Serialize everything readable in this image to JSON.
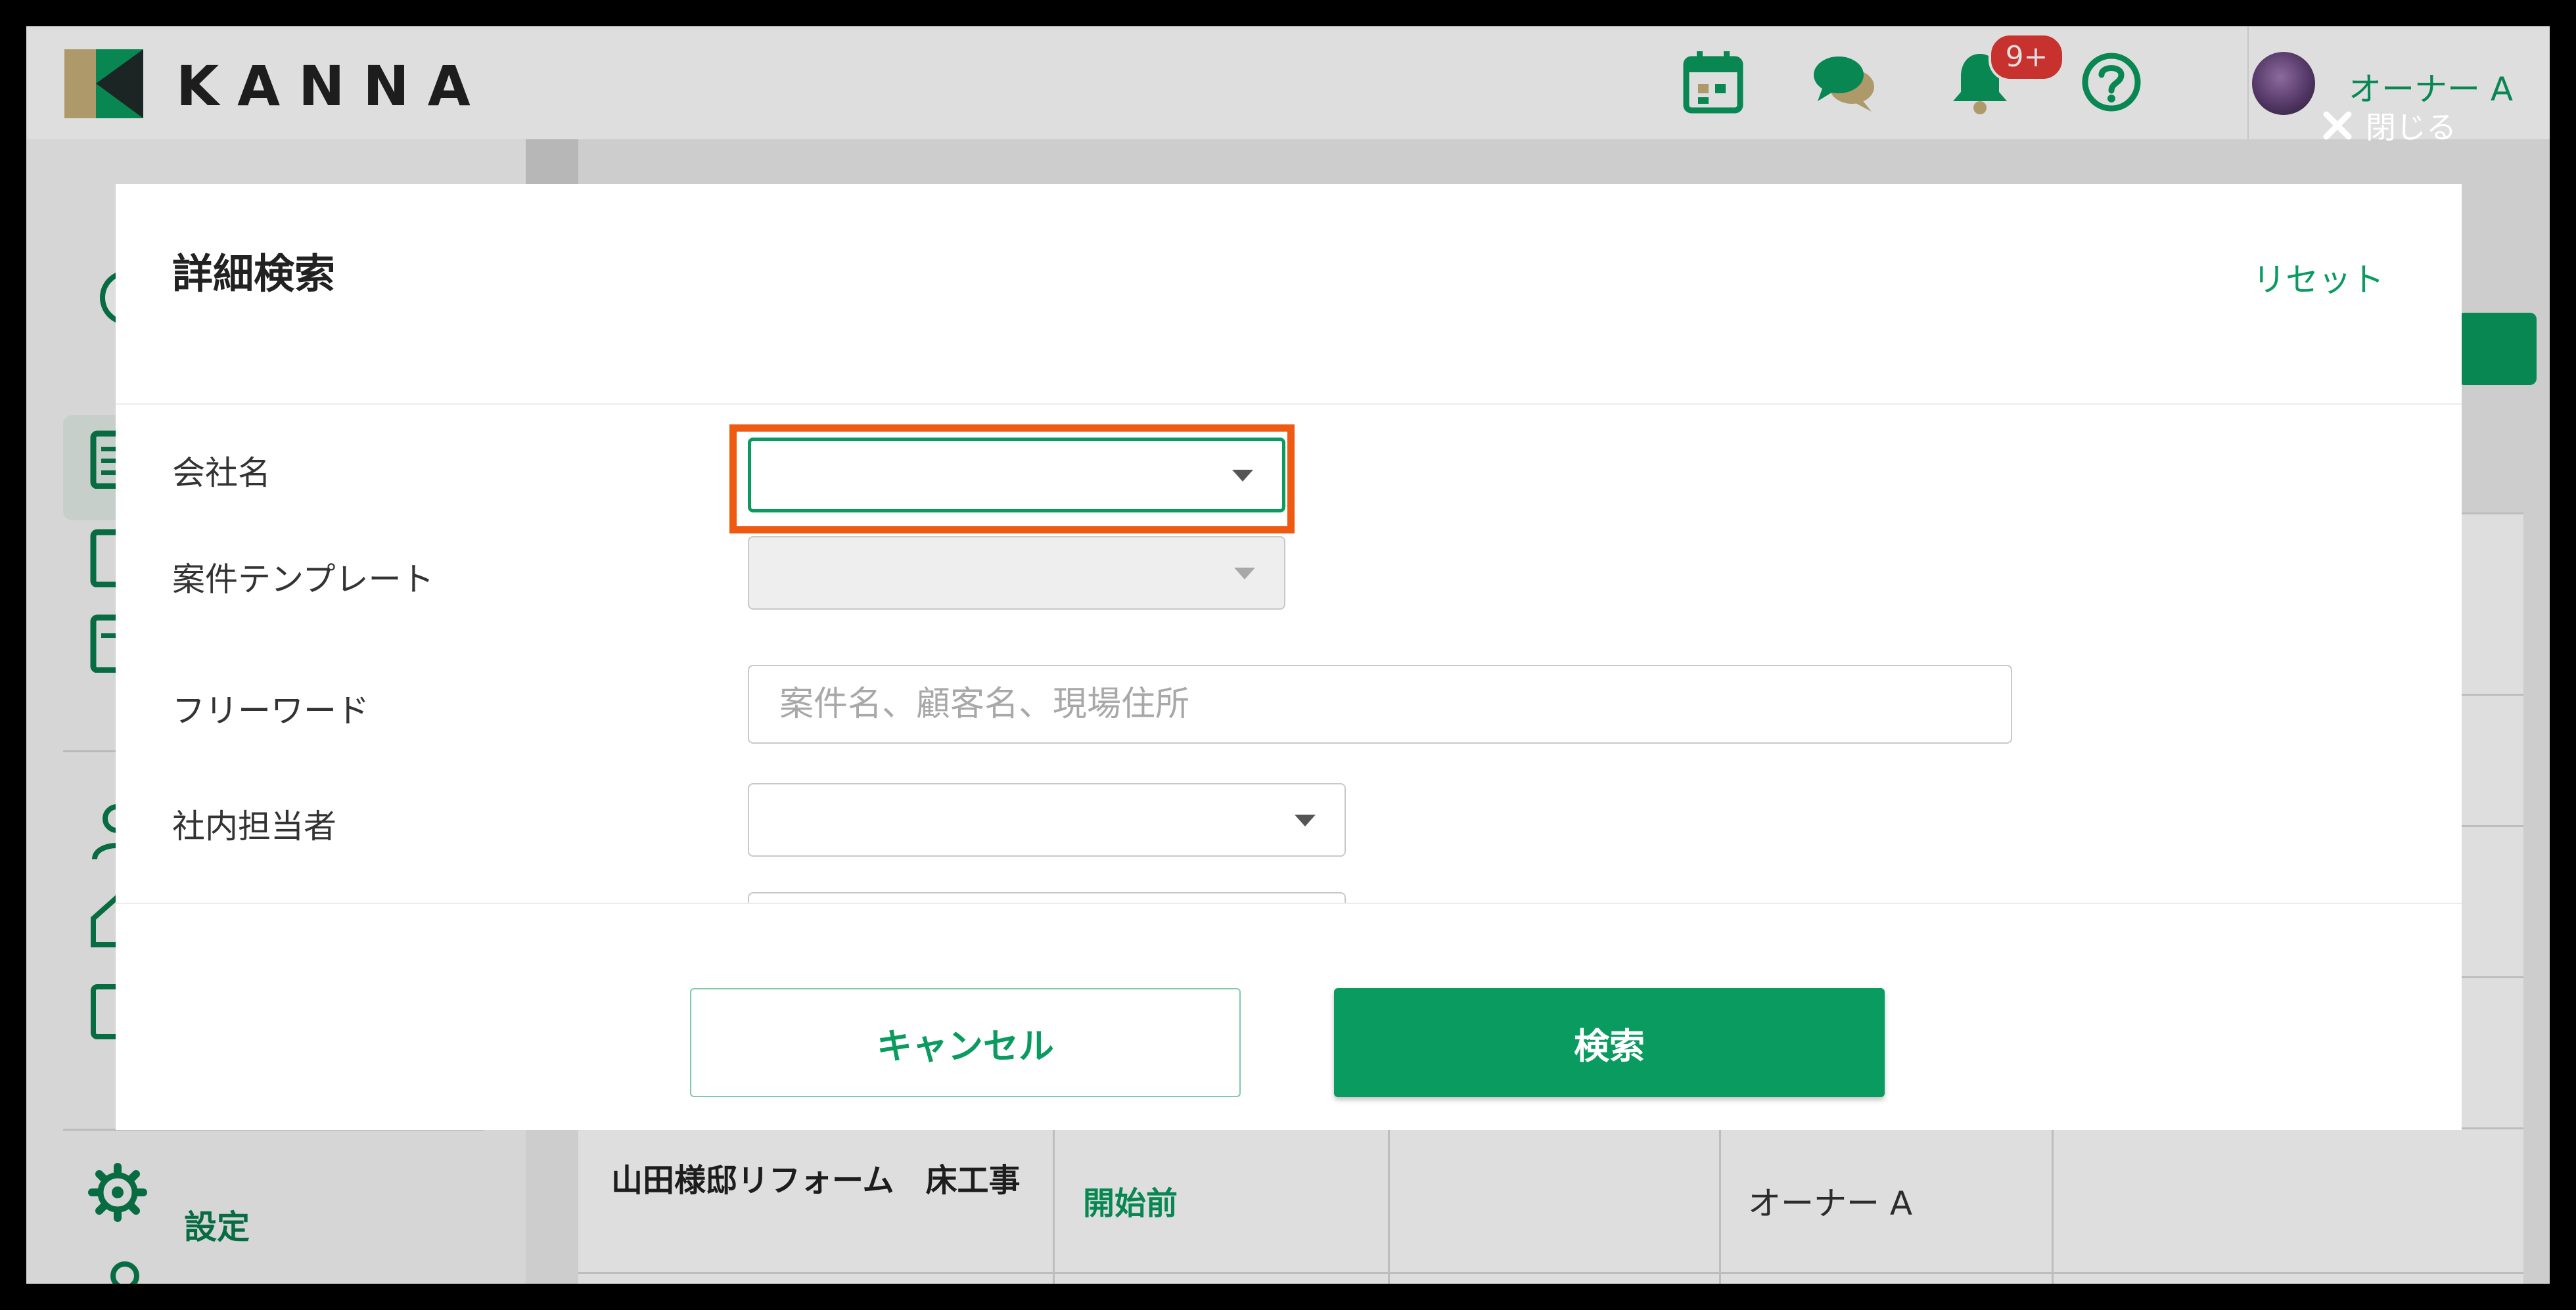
{
  "app": {
    "logo_text": "KANNA",
    "brand_color": "#0a9b60"
  },
  "header": {
    "notification_badge": "9+",
    "user_name": "オーナー A"
  },
  "overlay": {
    "close_label": "閉じる"
  },
  "sidebar": {
    "settings_label": "設定"
  },
  "table": {
    "row": {
      "title": "山田様邸リフォーム　床工事",
      "status": "開始前",
      "owner": "オーナー A"
    }
  },
  "modal": {
    "title": "詳細検索",
    "reset_label": "リセット",
    "fields": {
      "company": {
        "label": "会社名",
        "value": ""
      },
      "template": {
        "label": "案件テンプレート",
        "value": ""
      },
      "freeword": {
        "label": "フリーワード",
        "placeholder": "案件名、顧客名、現場住所"
      },
      "staff": {
        "label": "社内担当者",
        "value": ""
      }
    },
    "cancel_label": "キャンセル",
    "search_label": "検索"
  }
}
